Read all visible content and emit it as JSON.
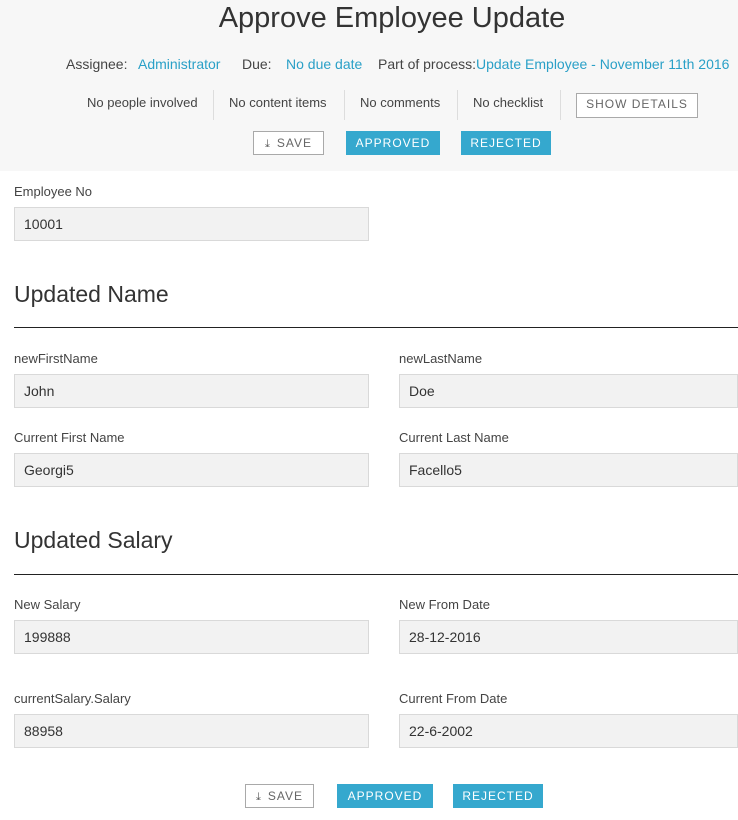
{
  "header": {
    "title": "Approve Employee Update",
    "assignee_label": "Assignee:",
    "assignee_value": "Administrator",
    "due_label": "Due:",
    "due_value": "No due date",
    "process_label": "Part of process:",
    "process_value": "Update Employee - November 11th 2016",
    "people": "No people involved",
    "content": "No content items",
    "comments": "No comments",
    "checklist": "No checklist",
    "show_details": "SHOW DETAILS"
  },
  "actions": {
    "save": "SAVE",
    "approved": "APPROVED",
    "rejected": "REJECTED"
  },
  "form": {
    "employee_no_label": "Employee No",
    "employee_no_value": "10001",
    "section_name": "Updated Name",
    "new_first_name_label": "newFirstName",
    "new_first_name_value": "John",
    "new_last_name_label": "newLastName",
    "new_last_name_value": "Doe",
    "current_first_name_label": "Current First Name",
    "current_first_name_value": "Georgi5",
    "current_last_name_label": "Current Last Name",
    "current_last_name_value": "Facello5",
    "section_salary": "Updated Salary",
    "new_salary_label": "New Salary",
    "new_salary_value": "199888",
    "new_from_date_label": "New From Date",
    "new_from_date_value": "28-12-2016",
    "current_salary_label": "currentSalary.Salary",
    "current_salary_value": "88958",
    "current_from_date_label": "Current From Date",
    "current_from_date_value": "22-6-2002"
  },
  "colors": {
    "accent": "#35a8ce",
    "link": "#2aa0c7",
    "header_bg": "#f7f7f7",
    "input_bg": "#f2f2f2"
  }
}
